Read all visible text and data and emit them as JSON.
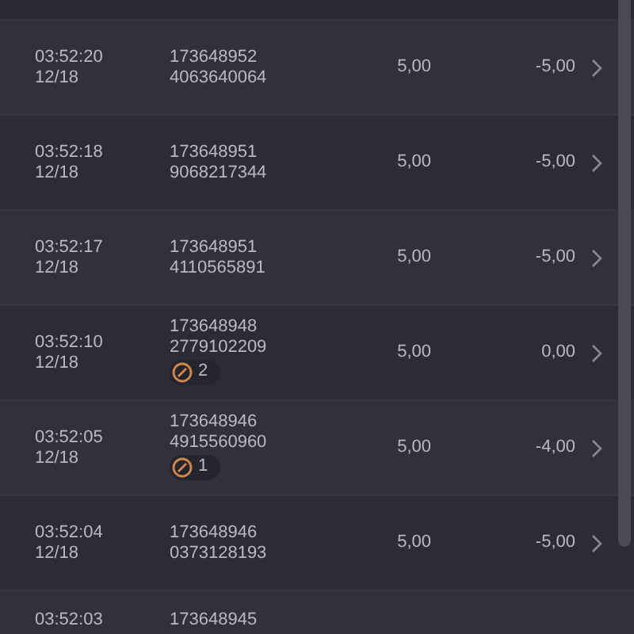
{
  "rows": [
    {
      "time": "03:52:20",
      "date": "12/18",
      "id_line_1": "173648952",
      "id_line_2": "4063640064",
      "amount": "5,00",
      "result": "-5,00"
    },
    {
      "time": "03:52:18",
      "date": "12/18",
      "id_line_1": "173648951",
      "id_line_2": "9068217344",
      "amount": "5,00",
      "result": "-5,00"
    },
    {
      "time": "03:52:17",
      "date": "12/18",
      "id_line_1": "173648951",
      "id_line_2": "4110565891",
      "amount": "5,00",
      "result": "-5,00"
    },
    {
      "time": "03:52:10",
      "date": "12/18",
      "id_line_1": "173648948",
      "id_line_2": "2779102209",
      "badge_count": "2",
      "amount": "5,00",
      "result": "0,00"
    },
    {
      "time": "03:52:05",
      "date": "12/18",
      "id_line_1": "173648946",
      "id_line_2": "4915560960",
      "badge_count": "1",
      "amount": "5,00",
      "result": "-4,00"
    },
    {
      "time": "03:52:04",
      "date": "12/18",
      "id_line_1": "173648946",
      "id_line_2": "0373128193",
      "amount": "5,00",
      "result": "-5,00"
    },
    {
      "time": "03:52:03",
      "id_line_1": "173648945"
    }
  ]
}
